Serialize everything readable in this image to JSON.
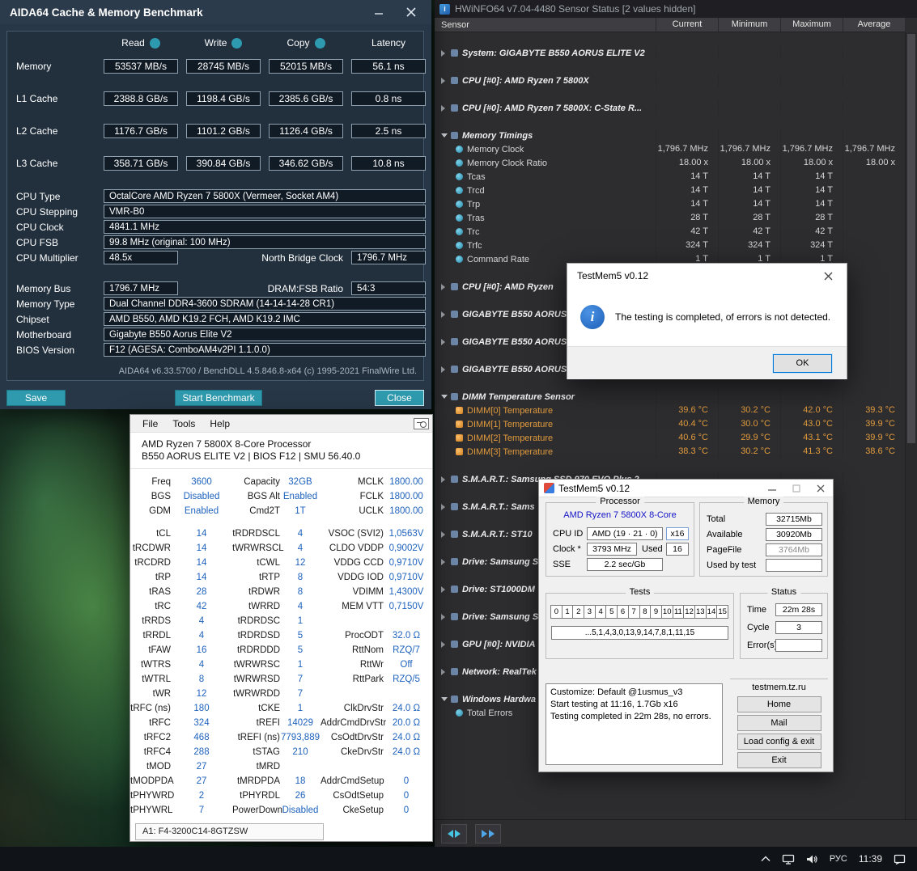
{
  "colors": {
    "aida_accent": "#2f9aae",
    "hwinfo_temp_orange": "#e09a3c",
    "zentimings_value_blue": "#1e62bd",
    "dialog_info_blue": "#2e7cd6"
  },
  "taskbar": {
    "lang": "РУС",
    "time": "11:39"
  },
  "aida64": {
    "title": "AIDA64 Cache & Memory Benchmark",
    "bench": {
      "col_headers": [
        "Read",
        "Write",
        "Copy",
        "Latency"
      ],
      "rows": [
        {
          "label": "Memory",
          "values": [
            "53537 MB/s",
            "28745 MB/s",
            "52015 MB/s",
            "56.1 ns"
          ]
        },
        {
          "label": "L1 Cache",
          "values": [
            "2388.8 GB/s",
            "1198.4 GB/s",
            "2385.6 GB/s",
            "0.8 ns"
          ]
        },
        {
          "label": "L2 Cache",
          "values": [
            "1176.7 GB/s",
            "1101.2 GB/s",
            "1126.4 GB/s",
            "2.5 ns"
          ]
        },
        {
          "label": "L3 Cache",
          "values": [
            "358.71 GB/s",
            "390.84 GB/s",
            "346.62 GB/s",
            "10.8 ns"
          ]
        }
      ]
    },
    "info": {
      "cpu_type_label": "CPU Type",
      "cpu_type": "OctalCore AMD Ryzen 7 5800X  (Vermeer, Socket AM4)",
      "cpu_stepping_label": "CPU Stepping",
      "cpu_stepping": "VMR-B0",
      "cpu_clock_label": "CPU Clock",
      "cpu_clock": "4841.1 MHz",
      "cpu_fsb_label": "CPU FSB",
      "cpu_fsb": "99.8 MHz  (original: 100 MHz)",
      "cpu_multiplier_label": "CPU Multiplier",
      "cpu_multiplier": "48.5x",
      "nb_clock_label": "North Bridge Clock",
      "nb_clock": "1796.7 MHz",
      "memory_bus_label": "Memory Bus",
      "memory_bus": "1796.7 MHz",
      "dram_fsb_label": "DRAM:FSB Ratio",
      "dram_fsb": "54:3",
      "memory_type_label": "Memory Type",
      "memory_type": "Dual Channel DDR4-3600 SDRAM  (14-14-14-28 CR1)",
      "chipset_label": "Chipset",
      "chipset": "AMD B550, AMD K19.2 FCH, AMD K19.2 IMC",
      "motherboard_label": "Motherboard",
      "motherboard": "Gigabyte B550 Aorus Elite V2",
      "bios_label": "BIOS Version",
      "bios": "F12  (AGESA: ComboAM4v2PI 1.1.0.0)"
    },
    "footer": "AIDA64 v6.33.5700 / BenchDLL 4.5.846.8-x64  (c) 1995-2021 FinalWire Ltd.",
    "buttons": {
      "save": "Save",
      "start": "Start Benchmark",
      "close": "Close"
    }
  },
  "hwinfo": {
    "title": "HWiNFO64 v7.04-4480 Sensor Status [2 values hidden]",
    "columns": [
      "Sensor",
      "Current",
      "Minimum",
      "Maximum",
      "Average"
    ],
    "rows": [
      {
        "type": "group",
        "state": "collapsed",
        "label": "System: GIGABYTE B550 AORUS ELITE V2",
        "values": [
          "",
          "",
          "",
          ""
        ]
      },
      {
        "type": "group",
        "state": "collapsed",
        "label": "CPU [#0]: AMD Ryzen 7 5800X",
        "values": [
          "",
          "",
          "",
          ""
        ]
      },
      {
        "type": "group",
        "state": "collapsed",
        "label": "CPU [#0]: AMD Ryzen 7 5800X: C-State R...",
        "values": [
          "",
          "",
          "",
          ""
        ]
      },
      {
        "type": "group",
        "state": "expanded",
        "label": "Memory Timings",
        "values": [
          "",
          "",
          "",
          ""
        ]
      },
      {
        "type": "sensor",
        "label": "Memory Clock",
        "values": [
          "1,796.7 MHz",
          "1,796.7 MHz",
          "1,796.7 MHz",
          "1,796.7 MHz"
        ]
      },
      {
        "type": "sensor",
        "label": "Memory Clock Ratio",
        "values": [
          "18.00 x",
          "18.00 x",
          "18.00 x",
          "18.00 x"
        ]
      },
      {
        "type": "sensor",
        "label": "Tcas",
        "values": [
          "14 T",
          "14 T",
          "14 T",
          ""
        ]
      },
      {
        "type": "sensor",
        "label": "Trcd",
        "values": [
          "14 T",
          "14 T",
          "14 T",
          ""
        ]
      },
      {
        "type": "sensor",
        "label": "Trp",
        "values": [
          "14 T",
          "14 T",
          "14 T",
          ""
        ]
      },
      {
        "type": "sensor",
        "label": "Tras",
        "values": [
          "28 T",
          "28 T",
          "28 T",
          ""
        ]
      },
      {
        "type": "sensor",
        "label": "Trc",
        "values": [
          "42 T",
          "42 T",
          "42 T",
          ""
        ]
      },
      {
        "type": "sensor",
        "label": "Trfc",
        "values": [
          "324 T",
          "324 T",
          "324 T",
          ""
        ]
      },
      {
        "type": "sensor",
        "label": "Command Rate",
        "values": [
          "1 T",
          "1 T",
          "1 T",
          ""
        ]
      },
      {
        "type": "group",
        "state": "collapsed",
        "label": "CPU [#0]: AMD Ryzen",
        "values": [
          "",
          "",
          "",
          ""
        ]
      },
      {
        "type": "group",
        "state": "collapsed",
        "label": "GIGABYTE B550 AORUS",
        "values": [
          "",
          "",
          "",
          ""
        ]
      },
      {
        "type": "group",
        "state": "collapsed",
        "label": "GIGABYTE B550 AORUS",
        "values": [
          "",
          "",
          "",
          ""
        ]
      },
      {
        "type": "group",
        "state": "collapsed",
        "label": "GIGABYTE B550 AORUS",
        "values": [
          "",
          "",
          "",
          ""
        ]
      },
      {
        "type": "group",
        "state": "expanded",
        "label": "DIMM Temperature Sensor",
        "values": [
          "",
          "",
          "",
          ""
        ]
      },
      {
        "type": "temp",
        "label": "DIMM[0] Temperature",
        "values": [
          "39.6 °C",
          "30.2 °C",
          "42.0 °C",
          "39.3 °C"
        ]
      },
      {
        "type": "temp",
        "label": "DIMM[1] Temperature",
        "values": [
          "40.4 °C",
          "30.0 °C",
          "43.0 °C",
          "39.9 °C"
        ]
      },
      {
        "type": "temp",
        "label": "DIMM[2] Temperature",
        "values": [
          "40.6 °C",
          "29.9 °C",
          "43.1 °C",
          "39.9 °C"
        ]
      },
      {
        "type": "temp",
        "label": "DIMM[3] Temperature",
        "values": [
          "38.3 °C",
          "30.2 °C",
          "41.3 °C",
          "38.6 °C"
        ]
      },
      {
        "type": "group",
        "state": "collapsed",
        "label": "S.M.A.R.T.: Samsung SSD 970 EVO Plus 2...",
        "values": [
          "",
          "",
          "",
          ""
        ]
      },
      {
        "type": "group",
        "state": "collapsed",
        "label": "S.M.A.R.T.: Sams",
        "values": [
          "",
          "",
          "",
          ""
        ]
      },
      {
        "type": "group",
        "state": "collapsed",
        "label": "S.M.A.R.T.: ST10",
        "values": [
          "",
          "",
          "",
          ""
        ]
      },
      {
        "type": "group",
        "state": "collapsed",
        "label": "Drive: Samsung S",
        "values": [
          "",
          "",
          "",
          ""
        ]
      },
      {
        "type": "group",
        "state": "collapsed",
        "label": "Drive: ST1000DM",
        "values": [
          "",
          "",
          "",
          ""
        ]
      },
      {
        "type": "group",
        "state": "collapsed",
        "label": "Drive: Samsung S",
        "values": [
          "",
          "",
          "",
          ""
        ]
      },
      {
        "type": "group",
        "state": "collapsed",
        "label": "GPU [#0]: NVIDIA",
        "values": [
          "",
          "",
          "",
          ""
        ]
      },
      {
        "type": "group",
        "state": "collapsed",
        "label": "Network: RealTek",
        "values": [
          "",
          "",
          "",
          ""
        ]
      },
      {
        "type": "group",
        "state": "expanded",
        "label": "Windows Hardwa",
        "values": [
          "",
          "",
          "",
          ""
        ]
      },
      {
        "type": "sensor",
        "label": "Total Errors",
        "values": [
          "",
          "",
          "",
          ""
        ]
      }
    ]
  },
  "zentimings": {
    "menu": [
      "File",
      "Tools",
      "Help"
    ],
    "cpu_line": "AMD Ryzen 7 5800X 8-Core Processor",
    "board_line": "B550 AORUS ELITE V2 | BIOS F12 | SMU 56.40.0",
    "top_rows": [
      [
        {
          "l": "Freq",
          "v": "3600"
        },
        {
          "l": "Capacity",
          "v": "32GB"
        },
        {
          "l": "MCLK",
          "v": "1800.00"
        }
      ],
      [
        {
          "l": "BGS",
          "v": "Disabled"
        },
        {
          "l": "BGS Alt",
          "v": "Enabled"
        },
        {
          "l": "FCLK",
          "v": "1800.00"
        }
      ],
      [
        {
          "l": "GDM",
          "v": "Enabled"
        },
        {
          "l": "Cmd2T",
          "v": "1T"
        },
        {
          "l": "UCLK",
          "v": "1800.00"
        }
      ]
    ],
    "rows": [
      [
        {
          "l": "tCL",
          "v": "14"
        },
        {
          "l": "tRDRDSCL",
          "v": "4"
        },
        {
          "l": "VSOC (SVI2)",
          "v": "1,0563V"
        }
      ],
      [
        {
          "l": "tRCDWR",
          "v": "14"
        },
        {
          "l": "tWRWRSCL",
          "v": "4"
        },
        {
          "l": "CLDO VDDP",
          "v": "0,9002V"
        }
      ],
      [
        {
          "l": "tRCDRD",
          "v": "14"
        },
        {
          "l": "tCWL",
          "v": "12"
        },
        {
          "l": "VDDG CCD",
          "v": "0,9710V"
        }
      ],
      [
        {
          "l": "tRP",
          "v": "14"
        },
        {
          "l": "tRTP",
          "v": "8"
        },
        {
          "l": "VDDG IOD",
          "v": "0,9710V"
        }
      ],
      [
        {
          "l": "tRAS",
          "v": "28"
        },
        {
          "l": "tRDWR",
          "v": "8"
        },
        {
          "l": "VDIMM",
          "v": "1,4300V"
        }
      ],
      [
        {
          "l": "tRC",
          "v": "42"
        },
        {
          "l": "tWRRD",
          "v": "4"
        },
        {
          "l": "MEM VTT",
          "v": "0,7150V"
        }
      ],
      [
        {
          "l": "tRRDS",
          "v": "4"
        },
        {
          "l": "tRDRDSC",
          "v": "1"
        },
        {
          "l": "",
          "v": ""
        }
      ],
      [
        {
          "l": "tRRDL",
          "v": "4"
        },
        {
          "l": "tRDRDSD",
          "v": "5"
        },
        {
          "l": "ProcODT",
          "v": "32.0 Ω"
        }
      ],
      [
        {
          "l": "tFAW",
          "v": "16"
        },
        {
          "l": "tRDRDDD",
          "v": "5"
        },
        {
          "l": "RttNom",
          "v": "RZQ/7"
        }
      ],
      [
        {
          "l": "tWTRS",
          "v": "4"
        },
        {
          "l": "tWRWRSC",
          "v": "1"
        },
        {
          "l": "RttWr",
          "v": "Off"
        }
      ],
      [
        {
          "l": "tWTRL",
          "v": "8"
        },
        {
          "l": "tWRWRSD",
          "v": "7"
        },
        {
          "l": "RttPark",
          "v": "RZQ/5"
        }
      ],
      [
        {
          "l": "tWR",
          "v": "12"
        },
        {
          "l": "tWRWRDD",
          "v": "7"
        },
        {
          "l": "",
          "v": ""
        }
      ],
      [
        {
          "l": "tRFC (ns)",
          "v": "180"
        },
        {
          "l": "tCKE",
          "v": "1"
        },
        {
          "l": "ClkDrvStr",
          "v": "24.0 Ω"
        }
      ],
      [
        {
          "l": "tRFC",
          "v": "324"
        },
        {
          "l": "tREFI",
          "v": "14029"
        },
        {
          "l": "AddrCmdDrvStr",
          "v": "20.0 Ω"
        }
      ],
      [
        {
          "l": "tRFC2",
          "v": "468"
        },
        {
          "l": "tREFI (ns)",
          "v": "7793,889"
        },
        {
          "l": "CsOdtDrvStr",
          "v": "24.0 Ω"
        }
      ],
      [
        {
          "l": "tRFC4",
          "v": "288"
        },
        {
          "l": "tSTAG",
          "v": "210"
        },
        {
          "l": "CkeDrvStr",
          "v": "24.0 Ω"
        }
      ],
      [
        {
          "l": "tMOD",
          "v": "27"
        },
        {
          "l": "tMRD",
          "v": ""
        },
        {
          "l": "",
          "v": ""
        }
      ],
      [
        {
          "l": "tMODPDA",
          "v": "27"
        },
        {
          "l": "tMRDPDA",
          "v": "18"
        },
        {
          "l": "AddrCmdSetup",
          "v": "0"
        }
      ],
      [
        {
          "l": "tPHYWRD",
          "v": "2"
        },
        {
          "l": "tPHYRDL",
          "v": "26"
        },
        {
          "l": "CsOdtSetup",
          "v": "0"
        }
      ],
      [
        {
          "l": "tPHYWRL",
          "v": "7"
        },
        {
          "l": "PowerDown",
          "v": "Disabled"
        },
        {
          "l": "CkeSetup",
          "v": "0"
        }
      ]
    ],
    "module": "A1: F4-3200C14-8GTZSW"
  },
  "tm5_dialog": {
    "title": "TestMem5 v0.12",
    "message": "The testing is completed, of errors is not detected.",
    "ok": "OK"
  },
  "tm5": {
    "title": "TestMem5 v0.12",
    "processor": {
      "group": "Processor",
      "name": "AMD Ryzen 7 5800X 8-Core",
      "cpuid_label": "CPU ID",
      "cpuid": "AMD (19 · 21 · 0)",
      "cpuid_x": "x16",
      "clock_label": "Clock *",
      "clock": "3793 MHz",
      "used_label": "Used",
      "used": "16",
      "sse_label": "SSE",
      "sse": "2.2 sec/Gb"
    },
    "memory": {
      "group": "Memory",
      "total_label": "Total",
      "total": "32715Mb",
      "available_label": "Available",
      "available": "30920Mb",
      "pagefile_label": "PageFile",
      "pagefile": "3764Mb",
      "used_by_test_label": "Used by test",
      "used_by_test": ""
    },
    "tests": {
      "group": "Tests",
      "cells": [
        "0",
        "1",
        "2",
        "3",
        "4",
        "5",
        "6",
        "7",
        "8",
        "9",
        "10",
        "11",
        "12",
        "13",
        "14",
        "15"
      ],
      "sequence": "...5,1,4,3,0,13,9,14,7,8,1,11,15"
    },
    "status": {
      "group": "Status",
      "time_label": "Time",
      "time": "22m 28s",
      "cycle_label": "Cycle",
      "cycle": "3",
      "errors_label": "Error(s)",
      "errors": ""
    },
    "log_lines": [
      "Customize: Default @1usmus_v3",
      "Start testing at 11:16, 1.7Gb x16",
      "Testing completed in 22m 28s, no errors."
    ],
    "site": "testmem.tz.ru",
    "buttons": [
      "Home",
      "Mail",
      "Load config & exit",
      "Exit"
    ]
  }
}
